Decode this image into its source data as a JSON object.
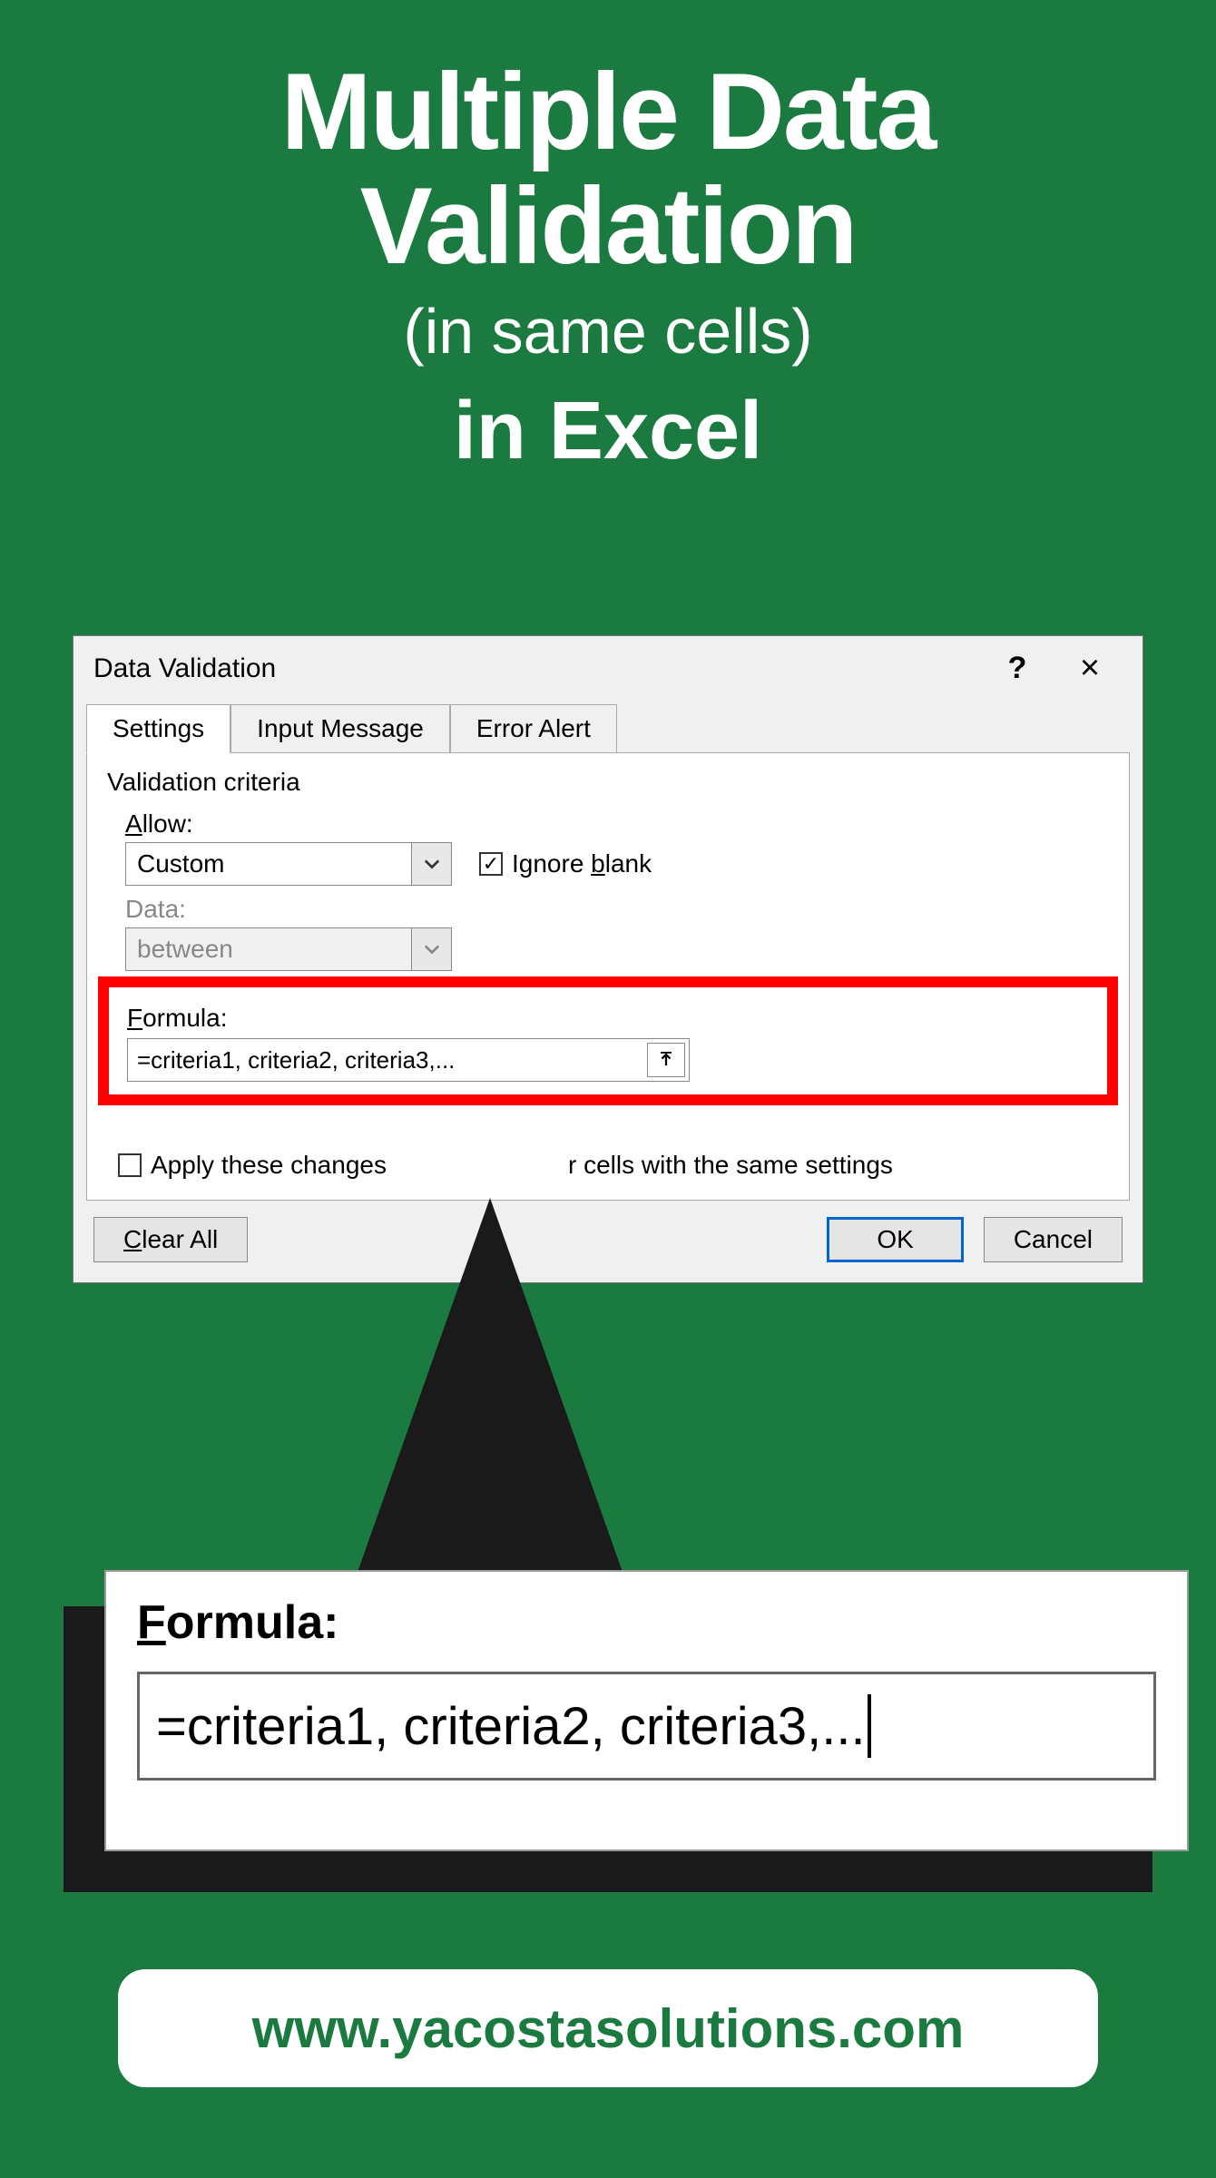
{
  "hero": {
    "line1": "Multiple Data",
    "line2": "Validation",
    "line3": "(in same cells)",
    "line4": "in Excel"
  },
  "dialog": {
    "title": "Data Validation",
    "tabs": {
      "settings": "Settings",
      "input_message": "Input Message",
      "error_alert": "Error Alert"
    },
    "section": "Validation criteria",
    "allow_label_pre": "A",
    "allow_label_post": "llow:",
    "allow_value": "Custom",
    "ignore_blank_pre": "Ignore ",
    "ignore_blank_u": "b",
    "ignore_blank_post": "lank",
    "data_label": "Data:",
    "data_value": "between",
    "formula_label_pre": "F",
    "formula_label_post": "ormula:",
    "formula_value": "=criteria1, criteria2, criteria3,...",
    "apply_pre": "Apply these changes",
    "apply_post": "r cells with the same settings",
    "clear_pre": "C",
    "clear_post": "lear All",
    "ok": "OK",
    "cancel": "Cancel"
  },
  "zoom": {
    "label_pre": "F",
    "label_post": "ormula:",
    "value": "=criteria1, criteria2, criteria3,..."
  },
  "url": "www.yacostasolutions.com"
}
